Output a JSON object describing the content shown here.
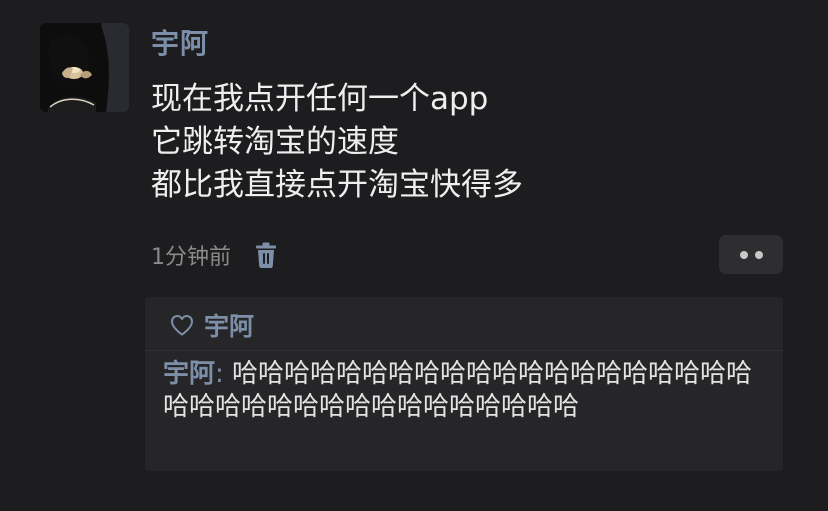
{
  "post": {
    "author": "宇阿",
    "content_lines": [
      "现在我点开任何一个app",
      "它跳转淘宝的速度",
      "都比我直接点开淘宝快得多"
    ],
    "time": "1分钟前",
    "icons": {
      "delete": "trash-icon",
      "more": "more-dots-icon",
      "like": "heart-outline-icon"
    }
  },
  "interaction": {
    "likes": [
      "宇阿"
    ],
    "comments": [
      {
        "author": "宇阿",
        "separator": ": ",
        "text": "哈哈哈哈哈哈哈哈哈哈哈哈哈哈哈哈哈哈哈哈哈哈哈哈哈哈哈哈哈哈哈哈哈哈哈哈"
      }
    ]
  },
  "colors": {
    "background": "#1d1d1f",
    "name_accent": "#7d8fa8",
    "panel": "#262628",
    "muted_text": "#8a8a8a"
  }
}
